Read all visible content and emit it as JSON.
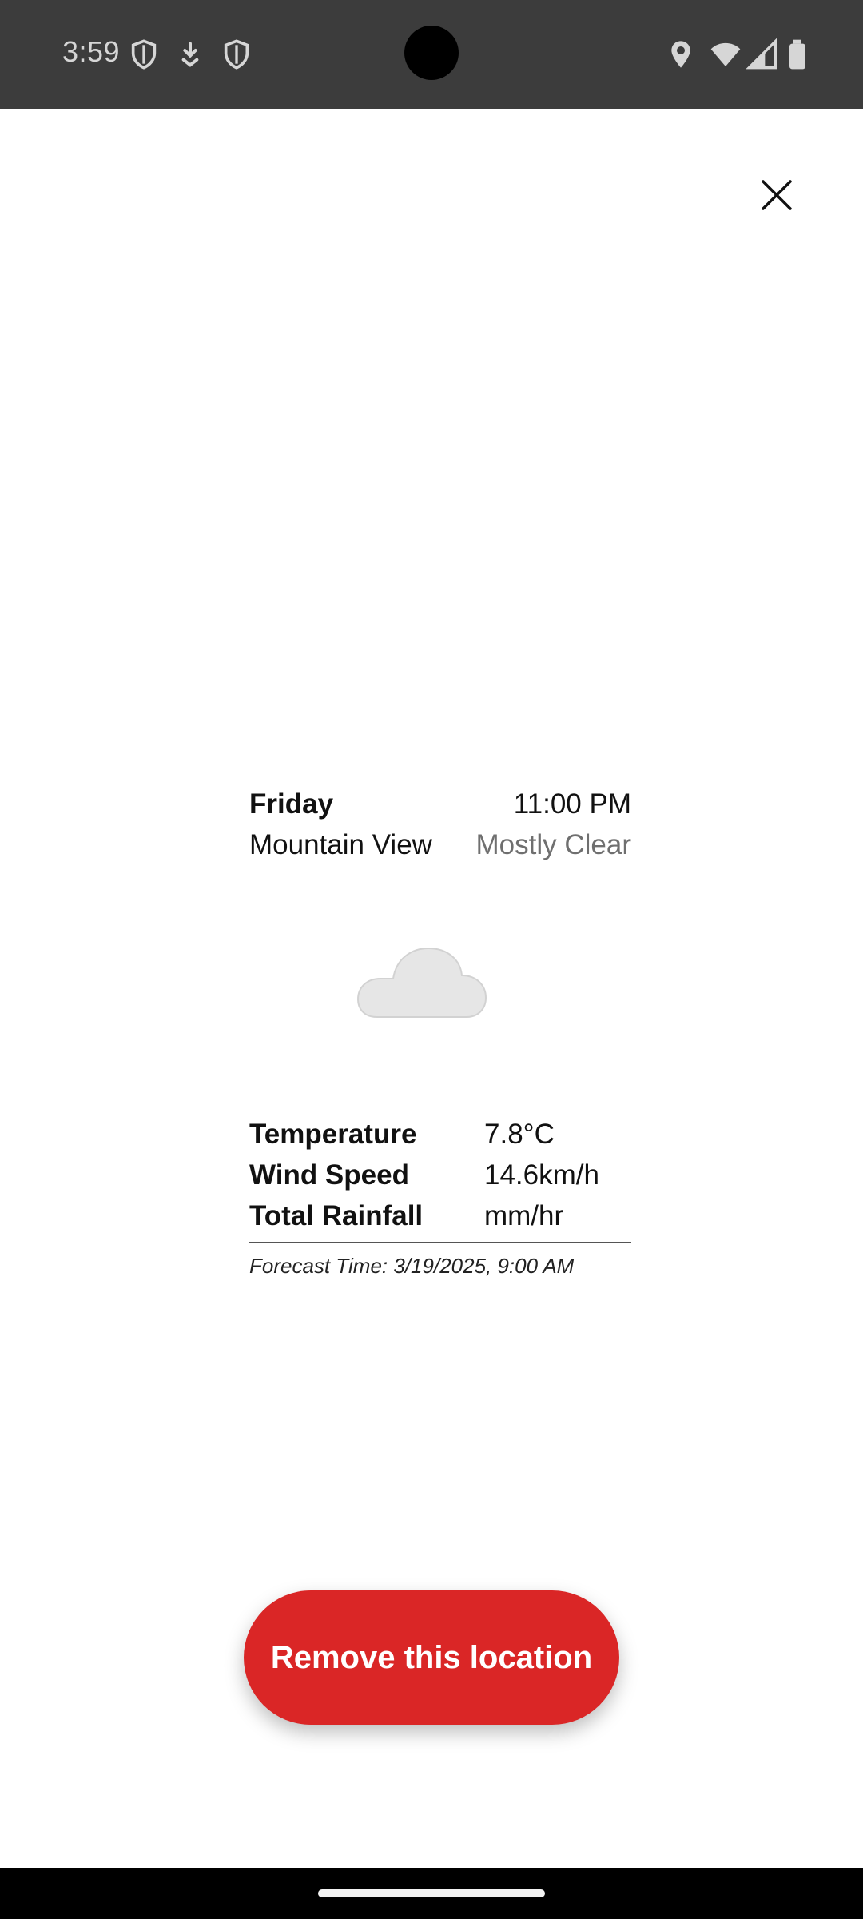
{
  "status_bar": {
    "time": "3:59",
    "left_icons": [
      "shield-icon",
      "download-icon",
      "shield-icon"
    ],
    "right_icons": [
      "location-icon",
      "wifi-icon",
      "signal-icon",
      "battery-icon"
    ]
  },
  "header": {
    "close_icon": "close-icon"
  },
  "weather": {
    "day": "Friday",
    "time": "11:00 PM",
    "location": "Mountain View",
    "condition": "Mostly Clear",
    "icon": "moon-cloud-icon"
  },
  "metrics": [
    {
      "label": "Temperature",
      "value": "7.8°C"
    },
    {
      "label": "Wind Speed",
      "value": "14.6km/h"
    },
    {
      "label": "Total Rainfall",
      "value": "mm/hr"
    }
  ],
  "forecast_time": "Forecast Time: 3/19/2025, 9:00 AM",
  "actions": {
    "remove_label": "Remove this location"
  },
  "colors": {
    "status_bar_bg": "#3c3c3c",
    "remove_button_bg": "#da2626",
    "condition_text": "#6f6f6f",
    "moon_fill": "#a9d8e8"
  }
}
